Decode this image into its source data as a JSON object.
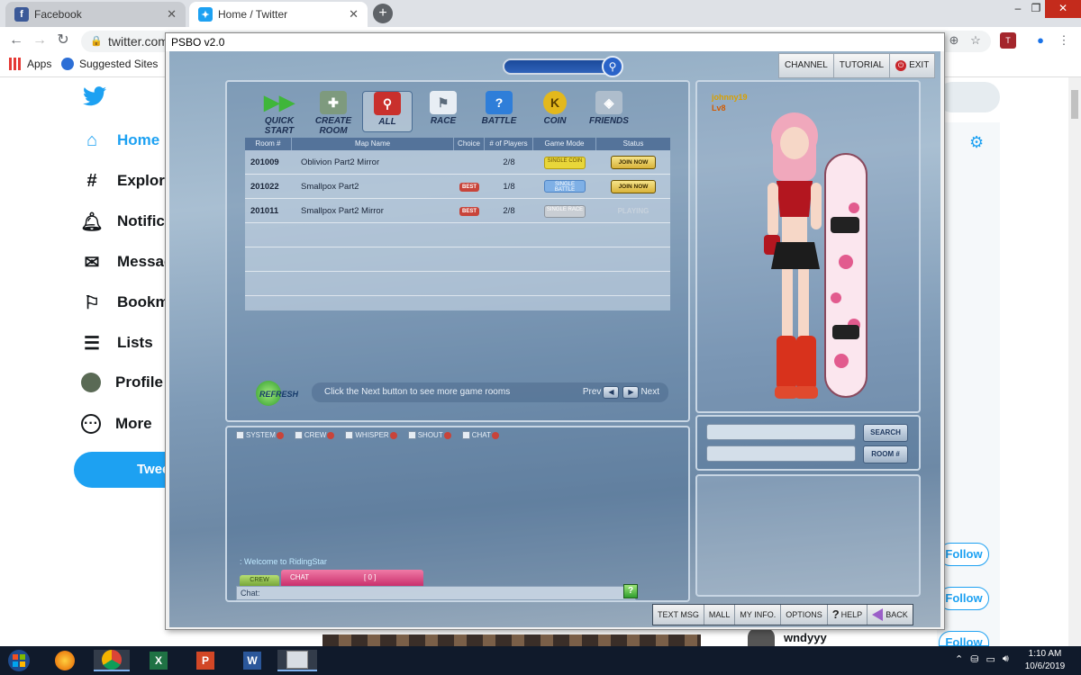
{
  "browser": {
    "tabs": [
      {
        "title": "Facebook",
        "favicon": "facebook-icon",
        "active": false
      },
      {
        "title": "Home / Twitter",
        "favicon": "twitter-icon",
        "active": true
      }
    ],
    "url_visible": "twitter.com/",
    "bookmarks": [
      {
        "label": "Apps",
        "icon": "apps-grid-icon"
      },
      {
        "label": "Suggested Sites",
        "icon": "suggested-sites-icon"
      }
    ]
  },
  "twitter": {
    "nav": [
      {
        "label": "Home",
        "icon": "home-icon",
        "active": true
      },
      {
        "label": "Explore",
        "icon": "hashtag-icon"
      },
      {
        "label": "Notific",
        "icon": "bell-icon"
      },
      {
        "label": "Messag",
        "icon": "mail-icon"
      },
      {
        "label": "Bookm",
        "icon": "bookmark-icon"
      },
      {
        "label": "Lists",
        "icon": "list-icon"
      },
      {
        "label": "Profile",
        "icon": "avatar-icon"
      },
      {
        "label": "More",
        "icon": "more-icon"
      }
    ],
    "tweet_button": "Twee",
    "follow_buttons": [
      "Follow",
      "Follow",
      "Follow"
    ],
    "bottom_user": "wndyyy",
    "accent": "#1da1f2"
  },
  "game": {
    "window_title": "PSBO v2.0",
    "top_menu": {
      "channel": "CHANNEL",
      "tutorial": "TUTORIAL",
      "exit": "EXIT"
    },
    "modes": [
      {
        "label": "QUICK\nSTART",
        "icon": "quickstart-icon",
        "color": "#3fb63a"
      },
      {
        "label": "CREATE\nROOM",
        "icon": "create-room-icon",
        "color": "#6e8a6e"
      },
      {
        "label": "ALL",
        "icon": "all-search-icon",
        "color": "#c9302c",
        "selected": true
      },
      {
        "label": "RACE",
        "icon": "race-flag-icon",
        "color": "#dfe6ee"
      },
      {
        "label": "BATTLE",
        "icon": "battle-question-icon",
        "color": "#2f7ed9"
      },
      {
        "label": "COIN",
        "icon": "coin-icon",
        "color": "#e3b81c"
      },
      {
        "label": "FRIENDS",
        "icon": "friends-icon",
        "color": "#9fb3c6"
      }
    ],
    "room_table": {
      "headers": [
        "Room #",
        "Map Name",
        "Choice",
        "# of Players",
        "Game Mode",
        "Status"
      ],
      "rows": [
        {
          "room": "201009",
          "map": "Oblivion Part2 Mirror",
          "choice": "",
          "players": "2/8",
          "mode": "SINGLE COIN",
          "mode_type": "coin",
          "status": "JOIN NOW"
        },
        {
          "room": "201022",
          "map": "Smallpox Part2",
          "choice": "BEST",
          "players": "1/8",
          "mode": "SINGLE BATTLE",
          "mode_type": "battle",
          "status": "JOIN NOW"
        },
        {
          "room": "201011",
          "map": "Smallpox Part2 Mirror",
          "choice": "BEST",
          "players": "2/8",
          "mode": "SINGLE RACE",
          "mode_type": "race",
          "status": "PLAYING"
        }
      ]
    },
    "refresh_label": "REFRESH",
    "next_hint": "Click the Next button to see more game rooms",
    "prev_label": "Prev",
    "next_label": "Next",
    "character": {
      "name": "johnny19",
      "level": "Lv8"
    },
    "chat_filters": [
      "SYSTEM",
      "CREW",
      "WHISPER",
      "SHOUT",
      "CHAT"
    ],
    "welcome_message": ": Welcome to RidingStar",
    "chat_crew_tab": "CREW",
    "chat_tab": "CHAT",
    "chat_count": "[ 0 ]",
    "chat_input_label": "Chat:",
    "search_button": "SEARCH",
    "room_search_button": "ROOM #",
    "bottom_menu": [
      "TEXT MSG",
      "MALL",
      "MY INFO.",
      "OPTIONS",
      "HELP",
      "BACK"
    ]
  },
  "taskbar": {
    "apps": [
      "windows-start-icon",
      "firefox-icon",
      "chrome-icon",
      "excel-icon",
      "powerpoint-icon",
      "word-icon",
      "psbo-icon"
    ],
    "time": "1:10 AM",
    "date": "10/6/2019"
  }
}
